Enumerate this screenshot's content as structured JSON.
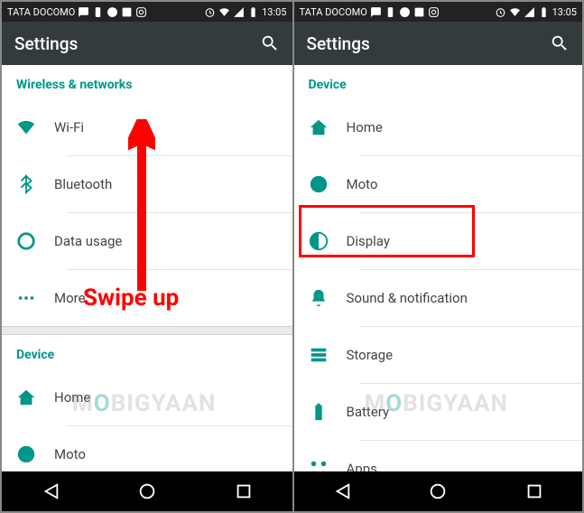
{
  "status": {
    "carrier": "TATA DOCOMO",
    "time": "13:05"
  },
  "appbar": {
    "title": "Settings"
  },
  "left": {
    "section1": "Wireless & networks",
    "items1": {
      "wifi": "Wi-Fi",
      "bt": "Bluetooth",
      "data": "Data usage",
      "more": "More"
    },
    "section2": "Device",
    "items2": {
      "home": "Home",
      "moto": "Moto"
    }
  },
  "right": {
    "section": "Device",
    "items": {
      "home": "Home",
      "moto": "Moto",
      "display": "Display",
      "sound": "Sound & notification",
      "storage": "Storage",
      "battery": "Battery",
      "apps": "Apps"
    }
  },
  "annotation": {
    "swipe": "Swipe up"
  },
  "watermark": {
    "pre": "M",
    "o": "O",
    "post": "BIGYAAN"
  }
}
